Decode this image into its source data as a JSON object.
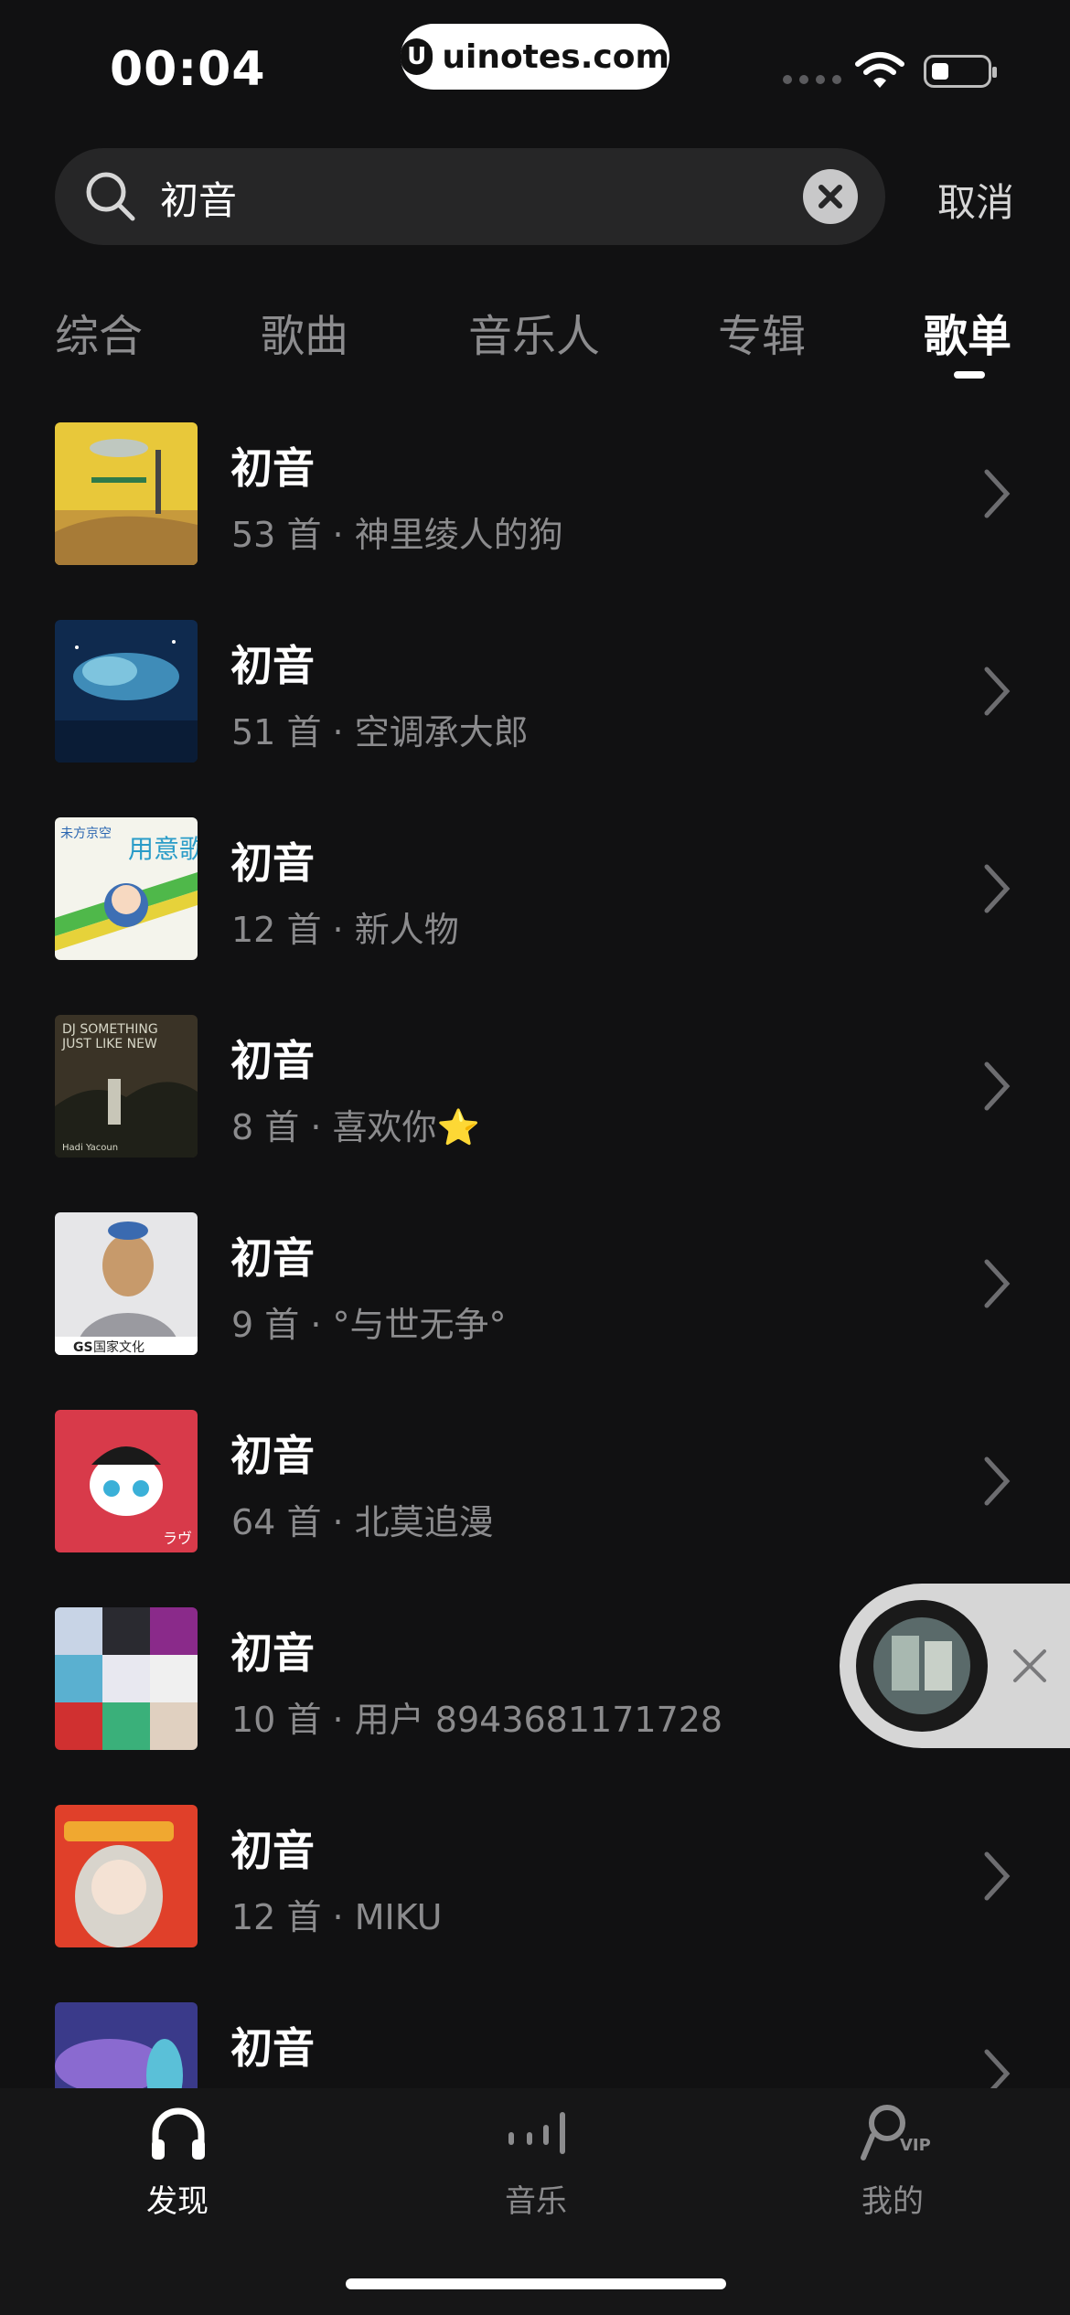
{
  "status_bar": {
    "time": "00:04",
    "watermark": "uinotes.com",
    "watermark_logo": "U"
  },
  "search": {
    "query": "初音",
    "cancel_label": "取消",
    "icons": {
      "search": "search-icon",
      "clear": "clear-circle-icon"
    }
  },
  "tabs": [
    {
      "label": "综合",
      "active": false
    },
    {
      "label": "歌曲",
      "active": false
    },
    {
      "label": "音乐人",
      "active": false
    },
    {
      "label": "专辑",
      "active": false
    },
    {
      "label": "歌单",
      "active": true
    }
  ],
  "playlists": [
    {
      "title": "初音",
      "count": "53",
      "unit": "首",
      "creator": "神里绫人的狗"
    },
    {
      "title": "初音",
      "count": "51",
      "unit": "首",
      "creator": "空调承大郎"
    },
    {
      "title": "初音",
      "count": "12",
      "unit": "首",
      "creator": "新人物"
    },
    {
      "title": "初音",
      "count": "8",
      "unit": "首",
      "creator": "喜欢你⭐"
    },
    {
      "title": "初音",
      "count": "9",
      "unit": "首",
      "creator": "°与世无争°"
    },
    {
      "title": "初音",
      "count": "64",
      "unit": "首",
      "creator": "北莫追漫"
    },
    {
      "title": "初音",
      "count": "10",
      "unit": "首",
      "creator": "用户 8943681171728"
    },
    {
      "title": "初音",
      "count": "12",
      "unit": "首",
      "creator": "MIKU"
    },
    {
      "title": "初音",
      "count": "",
      "unit": "",
      "creator": ""
    }
  ],
  "cover_texts": {
    "c3_top": "未方京空",
    "c3_big": "用意歌",
    "c4_line1": "DJ SOMETHING",
    "c4_line2": "JUST LIKE NEW",
    "c4_artist": "Hadi Yacoun",
    "c5_brand": "国家文化",
    "c5_logo": "GS",
    "c6_tag": "ラヴ"
  },
  "bottom_nav": [
    {
      "label": "发现",
      "icon": "headphones-icon",
      "active": true
    },
    {
      "label": "音乐",
      "icon": "equalizer-bars-icon",
      "active": false
    },
    {
      "label": "我的",
      "icon": "vip-profile-icon",
      "active": false
    }
  ],
  "colors": {
    "background": "#111112",
    "text_primary": "#ffffff",
    "text_secondary": "#8b8b8d",
    "search_bg": "#262627",
    "mini_player_bg": "#d6d6d6"
  }
}
